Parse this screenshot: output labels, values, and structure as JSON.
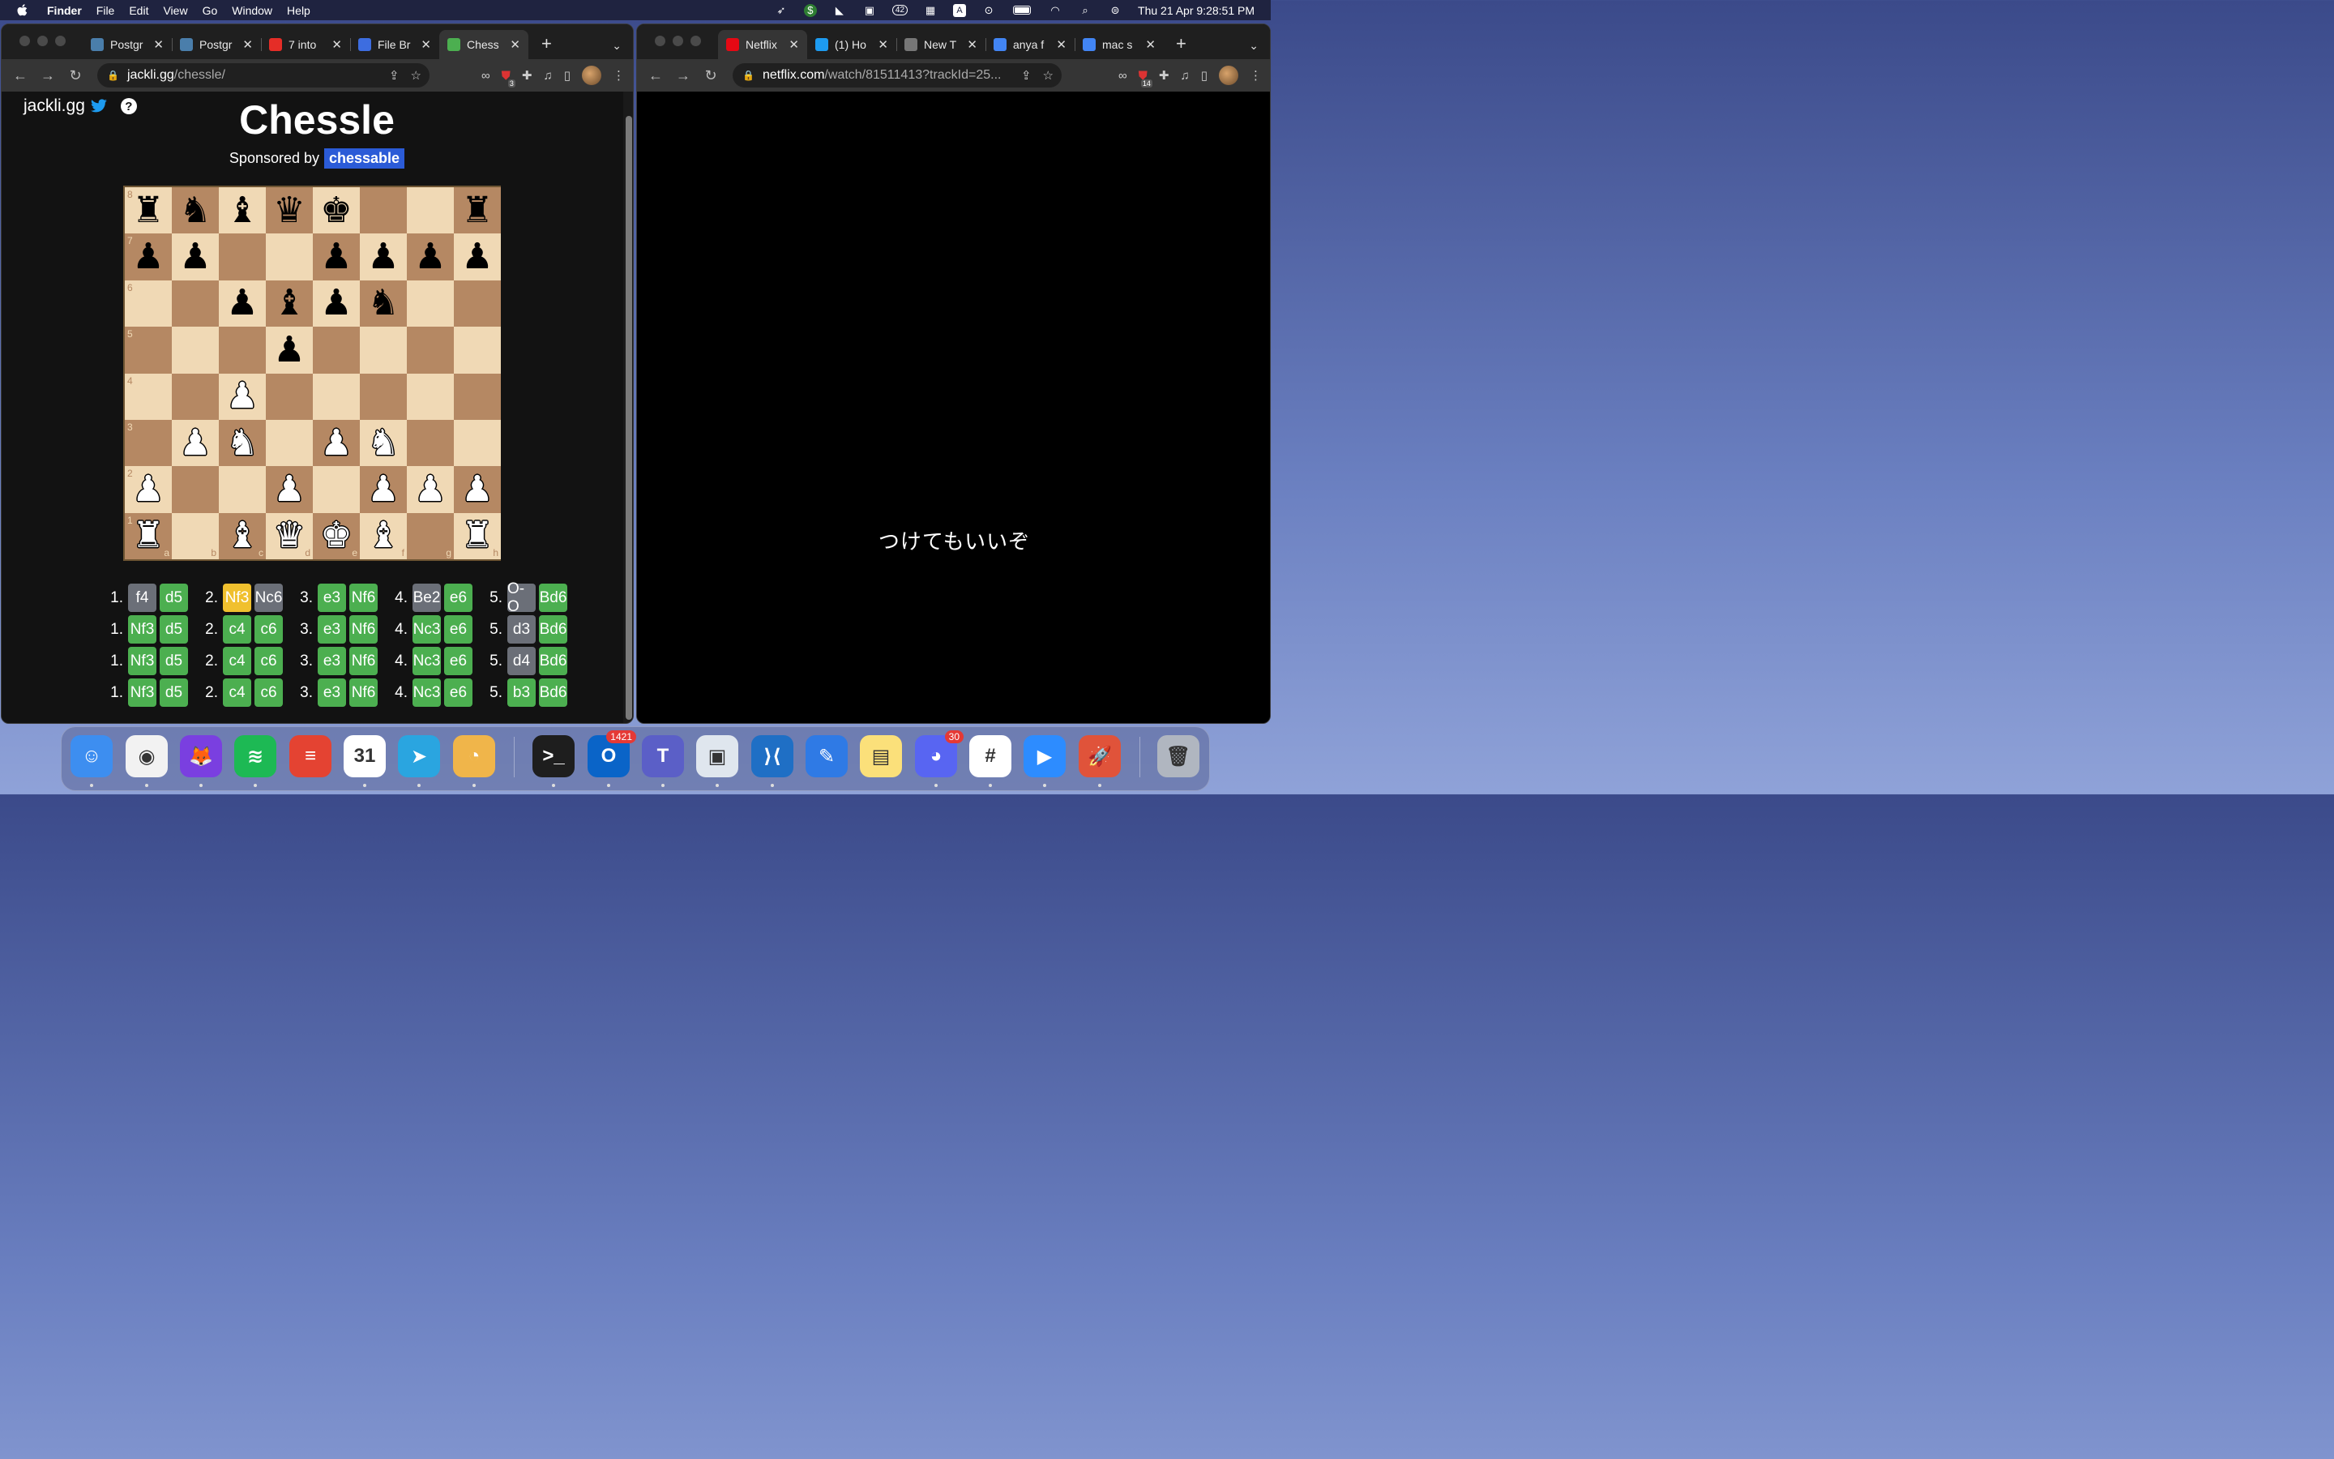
{
  "menubar": {
    "app": "Finder",
    "items": [
      "File",
      "Edit",
      "View",
      "Go",
      "Window",
      "Help"
    ],
    "status_icons": [
      "rocket-icon",
      "dollar-icon",
      "elephant-icon",
      "camera-icon",
      "notification-count-icon",
      "calendar-icon",
      "input-source-icon",
      "play-icon",
      "battery-icon",
      "wifi-icon",
      "search-icon",
      "control-center-icon"
    ],
    "notif_count": "42",
    "input_source": "A",
    "clock": "Thu 21 Apr  9:28:51 PM"
  },
  "left_window": {
    "tabs": [
      {
        "title": "Postgr",
        "icon": "postgres-icon",
        "color": "#4a7eab"
      },
      {
        "title": "Postgr",
        "icon": "postgres-icon",
        "color": "#4a7eab"
      },
      {
        "title": "7 into",
        "icon": "youtube-icon",
        "color": "#e52d27"
      },
      {
        "title": "File Br",
        "icon": "file-browser-icon",
        "color": "#3d6de0"
      },
      {
        "title": "Chess",
        "icon": "c4-icon",
        "color": "#4caf50",
        "active": true
      }
    ],
    "url_host": "jackli.gg",
    "url_rest": "/chessle/",
    "ext_badge": "3"
  },
  "right_window": {
    "tabs": [
      {
        "title": "Netflix",
        "icon": "netflix-icon",
        "color": "#e50914",
        "active": true
      },
      {
        "title": "(1) Ho",
        "icon": "twitter-icon",
        "color": "#1d9bf0"
      },
      {
        "title": "New T",
        "icon": "chrome-icon",
        "color": "#777"
      },
      {
        "title": "anya f",
        "icon": "google-icon",
        "color": "#4285f4"
      },
      {
        "title": "mac s",
        "icon": "google-icon",
        "color": "#4285f4"
      }
    ],
    "url_host": "netflix.com",
    "url_rest": "/watch/81511413?trackId=25...",
    "ext_badge": "14",
    "subtitle": "つけてもいいぞ"
  },
  "chessle": {
    "brand": "jackli.gg",
    "help": "?",
    "title": "Chessle",
    "sponsored_by": "Sponsored by",
    "sponsor": "chessable",
    "board": [
      [
        "br",
        "bn",
        "bb",
        "bq",
        "bk",
        "",
        "",
        "br"
      ],
      [
        "bp",
        "bp",
        "",
        "",
        "bp",
        "bp",
        "bp",
        "bp"
      ],
      [
        "",
        "",
        "bp",
        "bb",
        "bp",
        "bn",
        "",
        ""
      ],
      [
        "",
        "",
        "",
        "bp",
        "",
        "",
        "",
        ""
      ],
      [
        "",
        "",
        "wp",
        "",
        "",
        "",
        "",
        ""
      ],
      [
        "",
        "wp",
        "wn",
        "",
        "wp",
        "wn",
        "",
        ""
      ],
      [
        "wp",
        "",
        "",
        "wp",
        "",
        "wp",
        "wp",
        "wp"
      ],
      [
        "wr",
        "",
        "wb",
        "wq",
        "wk",
        "wb",
        "",
        "wr"
      ]
    ],
    "ranks": [
      "8",
      "7",
      "6",
      "5",
      "4",
      "3",
      "2",
      "1"
    ],
    "files": [
      "a",
      "b",
      "c",
      "d",
      "e",
      "f",
      "g",
      "h"
    ],
    "guesses": [
      [
        [
          "f4",
          "x"
        ],
        [
          "d5",
          "g"
        ],
        [
          "Nf3",
          "y"
        ],
        [
          "Nc6",
          "x"
        ],
        [
          "e3",
          "g"
        ],
        [
          "Nf6",
          "g"
        ],
        [
          "Be2",
          "x"
        ],
        [
          "e6",
          "g"
        ],
        [
          "O-O",
          "x"
        ],
        [
          "Bd6",
          "g"
        ]
      ],
      [
        [
          "Nf3",
          "g"
        ],
        [
          "d5",
          "g"
        ],
        [
          "c4",
          "g"
        ],
        [
          "c6",
          "g"
        ],
        [
          "e3",
          "g"
        ],
        [
          "Nf6",
          "g"
        ],
        [
          "Nc3",
          "g"
        ],
        [
          "e6",
          "g"
        ],
        [
          "d3",
          "x"
        ],
        [
          "Bd6",
          "g"
        ]
      ],
      [
        [
          "Nf3",
          "g"
        ],
        [
          "d5",
          "g"
        ],
        [
          "c4",
          "g"
        ],
        [
          "c6",
          "g"
        ],
        [
          "e3",
          "g"
        ],
        [
          "Nf6",
          "g"
        ],
        [
          "Nc3",
          "g"
        ],
        [
          "e6",
          "g"
        ],
        [
          "d4",
          "x"
        ],
        [
          "Bd6",
          "g"
        ]
      ],
      [
        [
          "Nf3",
          "g"
        ],
        [
          "d5",
          "g"
        ],
        [
          "c4",
          "g"
        ],
        [
          "c6",
          "g"
        ],
        [
          "e3",
          "g"
        ],
        [
          "Nf6",
          "g"
        ],
        [
          "Nc3",
          "g"
        ],
        [
          "e6",
          "g"
        ],
        [
          "b3",
          "g"
        ],
        [
          "Bd6",
          "g"
        ]
      ]
    ]
  },
  "dock": {
    "apps": [
      {
        "name": "finder-icon",
        "bg": "#3d8ef0",
        "glyph": "☺",
        "running": true
      },
      {
        "name": "chrome-icon",
        "bg": "#f2f2f2",
        "glyph": "◉",
        "running": true
      },
      {
        "name": "firefox-icon",
        "bg": "#7a3fe0",
        "glyph": "🦊",
        "running": true
      },
      {
        "name": "spotify-icon",
        "bg": "#1db954",
        "glyph": "≋",
        "running": true
      },
      {
        "name": "todoist-icon",
        "bg": "#e44332",
        "glyph": "≡",
        "running": false
      },
      {
        "name": "calendar-icon",
        "bg": "#ffffff",
        "glyph": "31",
        "running": true
      },
      {
        "name": "telegram-icon",
        "bg": "#2aa5e0",
        "glyph": "➤",
        "running": true
      },
      {
        "name": "cheese-icon",
        "bg": "#f0b54a",
        "glyph": "◔",
        "running": true
      },
      {
        "name": "terminal-icon",
        "bg": "#1e1e1e",
        "glyph": ">_",
        "running": true
      },
      {
        "name": "outlook-icon",
        "bg": "#0a64c8",
        "glyph": "O",
        "running": true,
        "badge": "1421"
      },
      {
        "name": "teams-icon",
        "bg": "#5b5fc7",
        "glyph": "T",
        "running": true
      },
      {
        "name": "preview-icon",
        "bg": "#dfe6ee",
        "glyph": "▣",
        "running": true
      },
      {
        "name": "vscode-icon",
        "bg": "#1f6fc5",
        "glyph": "⟩⟨",
        "running": true
      },
      {
        "name": "pencil-icon",
        "bg": "#2f7ae5",
        "glyph": "✎",
        "running": false
      },
      {
        "name": "notes-icon",
        "bg": "#fbe07a",
        "glyph": "▤",
        "running": false
      },
      {
        "name": "discord-icon",
        "bg": "#5865f2",
        "glyph": "◕",
        "running": true,
        "badge": "30"
      },
      {
        "name": "slack-icon",
        "bg": "#ffffff",
        "glyph": "#",
        "running": true
      },
      {
        "name": "zoom-icon",
        "bg": "#2d8cff",
        "glyph": "▶",
        "running": true
      },
      {
        "name": "rocket-icon",
        "bg": "#e0533a",
        "glyph": "🚀",
        "running": true
      },
      {
        "name": "trash-icon",
        "bg": "#b0b6c0",
        "glyph": "🗑",
        "running": false
      }
    ]
  }
}
